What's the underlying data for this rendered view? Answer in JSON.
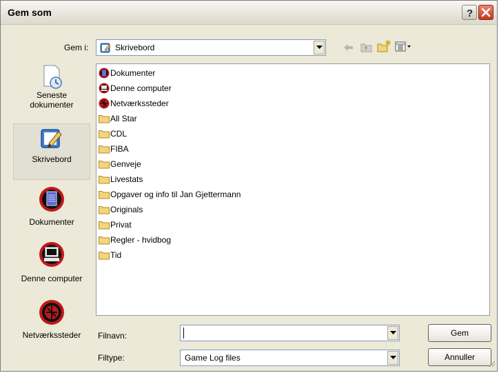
{
  "dialog": {
    "title": "Gem som",
    "help_icon": "help-icon",
    "close_icon": "close-icon"
  },
  "save_in": {
    "label": "Gem i:",
    "value": "Skrivebord",
    "icon": "desktop-icon"
  },
  "toolbar": {
    "icons": [
      "back-arrow-icon",
      "up-folder-icon",
      "new-folder-icon",
      "views-menu-icon"
    ]
  },
  "places": [
    {
      "label": "Seneste dokumenter",
      "line1": "Seneste",
      "line2": "dokumenter",
      "icon": "recent-documents-icon",
      "selected": false
    },
    {
      "label": "Skrivebord",
      "icon": "desktop-icon",
      "selected": true
    },
    {
      "label": "Dokumenter",
      "icon": "my-documents-icon",
      "selected": false
    },
    {
      "label": "Denne computer",
      "icon": "computer-icon",
      "selected": false
    },
    {
      "label": "Netværkssteder",
      "icon": "network-places-icon",
      "selected": false
    }
  ],
  "files": [
    {
      "name": "Dokumenter",
      "icon": "my-documents-icon"
    },
    {
      "name": "Denne computer",
      "icon": "computer-icon"
    },
    {
      "name": "Netværkssteder",
      "icon": "network-places-icon"
    },
    {
      "name": "All Star",
      "icon": "folder-icon"
    },
    {
      "name": "CDL",
      "icon": "folder-icon"
    },
    {
      "name": "FIBA",
      "icon": "folder-icon"
    },
    {
      "name": "Genveje",
      "icon": "folder-icon"
    },
    {
      "name": "Livestats",
      "icon": "folder-icon"
    },
    {
      "name": "Opgaver og info til Jan Gjettermann",
      "icon": "folder-icon"
    },
    {
      "name": "Originals",
      "icon": "folder-icon"
    },
    {
      "name": "Privat",
      "icon": "folder-icon"
    },
    {
      "name": "Regler - hvidbog",
      "icon": "folder-icon"
    },
    {
      "name": "Tid",
      "icon": "folder-icon"
    }
  ],
  "filename": {
    "label": "Filnavn:",
    "value": ""
  },
  "filetype": {
    "label": "Filtype:",
    "value": "Game Log files"
  },
  "buttons": {
    "save": "Gem",
    "cancel": "Annuller"
  },
  "colors": {
    "dialog_bg": "#ece9d8",
    "folder": "#f3d67a",
    "badge": "#c01818"
  }
}
